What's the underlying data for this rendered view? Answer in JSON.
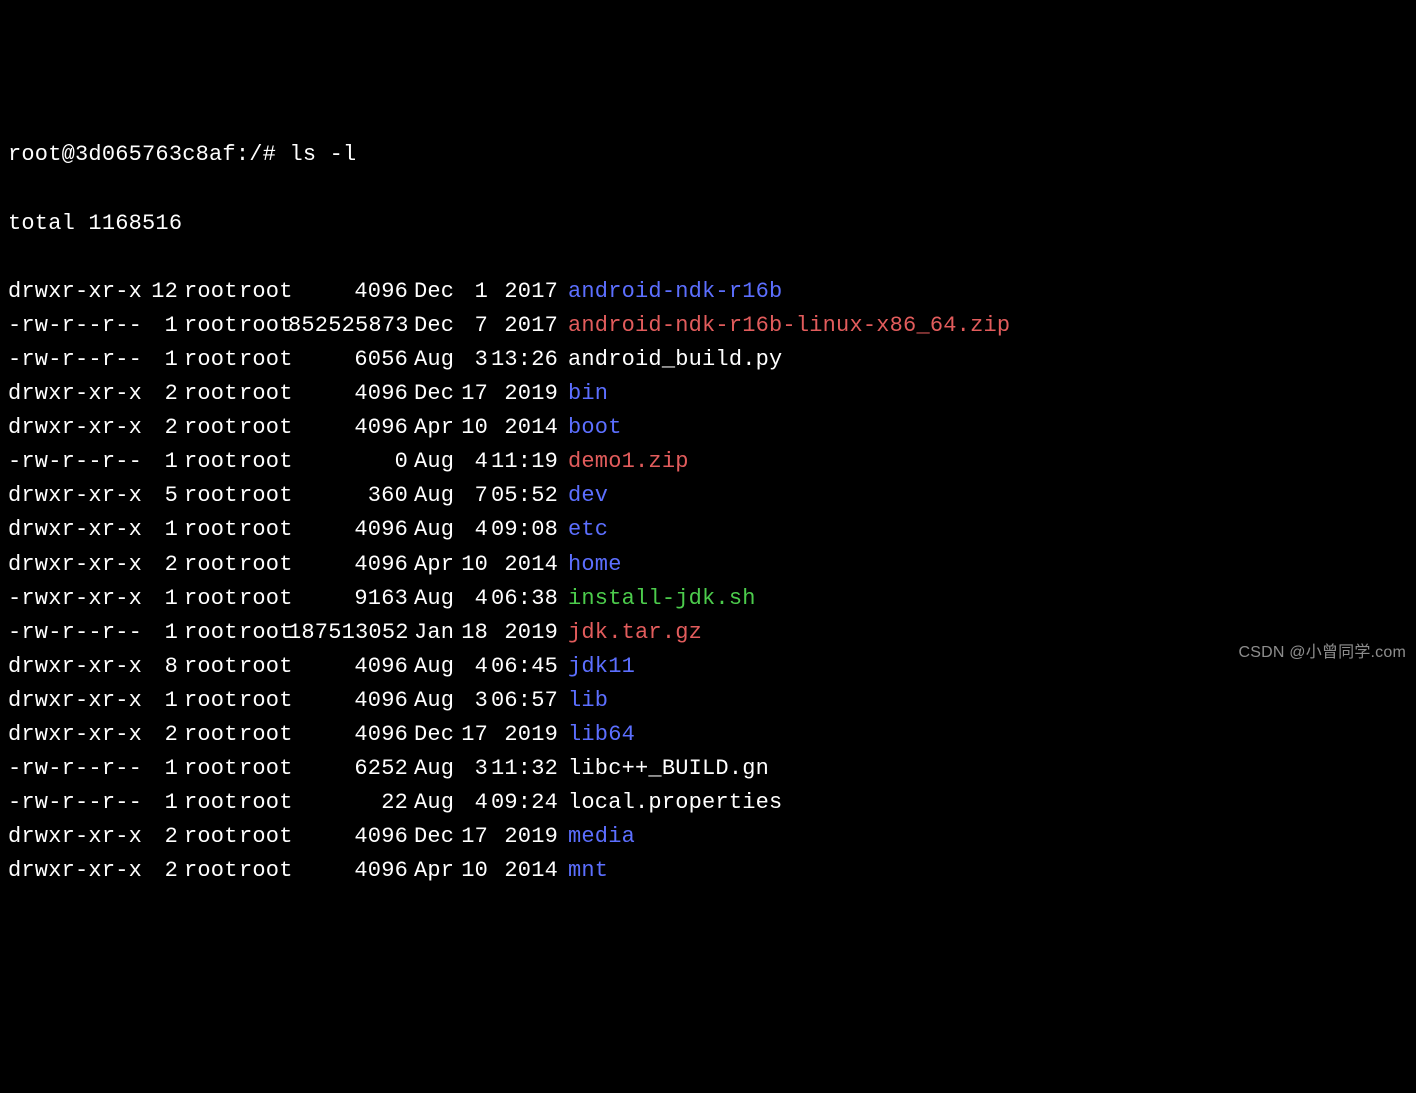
{
  "prompt": "root@3d065763c8af:/# ",
  "command": "ls -l",
  "total_line": "total 1168516",
  "watermark": "CSDN @小曾同学.com",
  "color_classes": {
    "file": "clr-file",
    "dir": "clr-dir",
    "archive": "clr-archive",
    "exec": "clr-exec"
  },
  "entries": [
    {
      "perms": "drwxr-xr-x",
      "links": "12",
      "owner": "root",
      "group": "root",
      "size": "4096",
      "month": "Dec",
      "day": "1",
      "year": "2017",
      "name": "android-ndk-r16b",
      "type": "dir"
    },
    {
      "perms": "-rw-r--r--",
      "links": "1",
      "owner": "root",
      "group": "root",
      "size": "852525873",
      "month": "Dec",
      "day": "7",
      "year": "2017",
      "name": "android-ndk-r16b-linux-x86_64.zip",
      "type": "archive"
    },
    {
      "perms": "-rw-r--r--",
      "links": "1",
      "owner": "root",
      "group": "root",
      "size": "6056",
      "month": "Aug",
      "day": "3",
      "year": "13:26",
      "name": "android_build.py",
      "type": "file"
    },
    {
      "perms": "drwxr-xr-x",
      "links": "2",
      "owner": "root",
      "group": "root",
      "size": "4096",
      "month": "Dec",
      "day": "17",
      "year": "2019",
      "name": "bin",
      "type": "dir"
    },
    {
      "perms": "drwxr-xr-x",
      "links": "2",
      "owner": "root",
      "group": "root",
      "size": "4096",
      "month": "Apr",
      "day": "10",
      "year": "2014",
      "name": "boot",
      "type": "dir"
    },
    {
      "perms": "-rw-r--r--",
      "links": "1",
      "owner": "root",
      "group": "root",
      "size": "0",
      "month": "Aug",
      "day": "4",
      "year": "11:19",
      "name": "demo1.zip",
      "type": "archive"
    },
    {
      "perms": "drwxr-xr-x",
      "links": "5",
      "owner": "root",
      "group": "root",
      "size": "360",
      "month": "Aug",
      "day": "7",
      "year": "05:52",
      "name": "dev",
      "type": "dir"
    },
    {
      "perms": "drwxr-xr-x",
      "links": "1",
      "owner": "root",
      "group": "root",
      "size": "4096",
      "month": "Aug",
      "day": "4",
      "year": "09:08",
      "name": "etc",
      "type": "dir"
    },
    {
      "perms": "drwxr-xr-x",
      "links": "2",
      "owner": "root",
      "group": "root",
      "size": "4096",
      "month": "Apr",
      "day": "10",
      "year": "2014",
      "name": "home",
      "type": "dir"
    },
    {
      "perms": "-rwxr-xr-x",
      "links": "1",
      "owner": "root",
      "group": "root",
      "size": "9163",
      "month": "Aug",
      "day": "4",
      "year": "06:38",
      "name": "install-jdk.sh",
      "type": "exec"
    },
    {
      "perms": "-rw-r--r--",
      "links": "1",
      "owner": "root",
      "group": "root",
      "size": "187513052",
      "month": "Jan",
      "day": "18",
      "year": "2019",
      "name": "jdk.tar.gz",
      "type": "archive"
    },
    {
      "perms": "drwxr-xr-x",
      "links": "8",
      "owner": "root",
      "group": "root",
      "size": "4096",
      "month": "Aug",
      "day": "4",
      "year": "06:45",
      "name": "jdk11",
      "type": "dir"
    },
    {
      "perms": "drwxr-xr-x",
      "links": "1",
      "owner": "root",
      "group": "root",
      "size": "4096",
      "month": "Aug",
      "day": "3",
      "year": "06:57",
      "name": "lib",
      "type": "dir"
    },
    {
      "perms": "drwxr-xr-x",
      "links": "2",
      "owner": "root",
      "group": "root",
      "size": "4096",
      "month": "Dec",
      "day": "17",
      "year": "2019",
      "name": "lib64",
      "type": "dir"
    },
    {
      "perms": "-rw-r--r--",
      "links": "1",
      "owner": "root",
      "group": "root",
      "size": "6252",
      "month": "Aug",
      "day": "3",
      "year": "11:32",
      "name": "libc++_BUILD.gn",
      "type": "file"
    },
    {
      "perms": "-rw-r--r--",
      "links": "1",
      "owner": "root",
      "group": "root",
      "size": "22",
      "month": "Aug",
      "day": "4",
      "year": "09:24",
      "name": "local.properties",
      "type": "file"
    },
    {
      "perms": "drwxr-xr-x",
      "links": "2",
      "owner": "root",
      "group": "root",
      "size": "4096",
      "month": "Dec",
      "day": "17",
      "year": "2019",
      "name": "media",
      "type": "dir"
    },
    {
      "perms": "drwxr-xr-x",
      "links": "2",
      "owner": "root",
      "group": "root",
      "size": "4096",
      "month": "Apr",
      "day": "10",
      "year": "2014",
      "name": "mnt",
      "type": "dir"
    }
  ]
}
